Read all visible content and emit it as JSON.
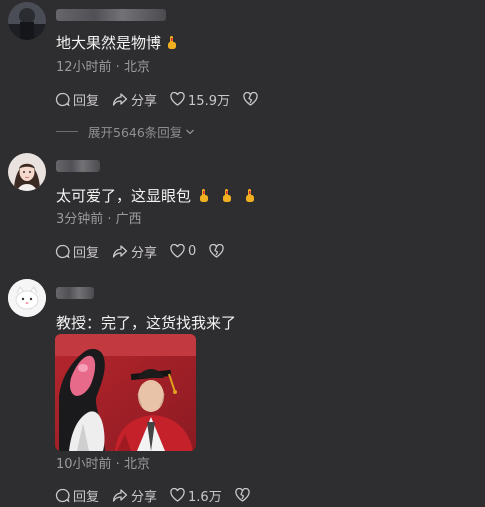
{
  "comments": [
    {
      "text": "地大果然是物博",
      "meta": "12小时前 · 北京",
      "reply_label": "回复",
      "share_label": "分享",
      "like_count": "15.9万",
      "expand_label": "展开5646条回复",
      "avatar_icon": "avatar-dark-figure-icon"
    },
    {
      "text": "太可爱了，这显眼包",
      "meta": "3分钟前 · 广西",
      "reply_label": "回复",
      "share_label": "分享",
      "like_count": "0",
      "avatar_icon": "avatar-girl-photo-icon"
    },
    {
      "text": "教授：完了，这货找我来了",
      "meta": "10小时前 · 北京",
      "reply_label": "回复",
      "share_label": "分享",
      "like_count": "1.6万",
      "avatar_icon": "avatar-white-cat-icon"
    }
  ],
  "emoji_icon": "hand-emoji-icon",
  "colors": {
    "background": "#2e2d2f",
    "text": "#f3f3f3",
    "meta": "#9b9a9e",
    "graduation_red": "#b3202a"
  }
}
